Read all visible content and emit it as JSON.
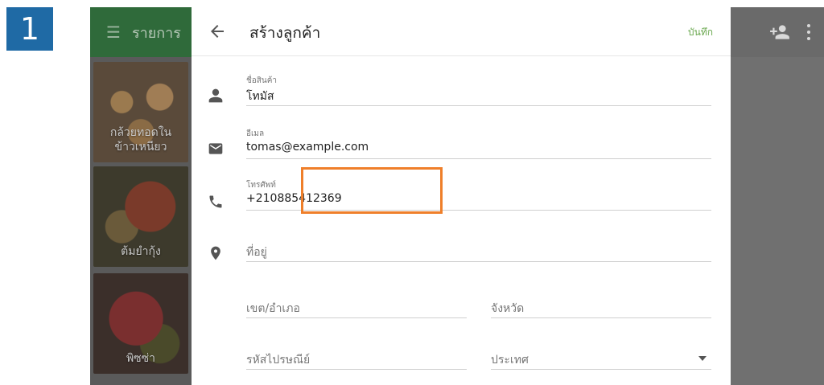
{
  "step": {
    "number": "1"
  },
  "background": {
    "left_title": "รายการ",
    "items": [
      {
        "label_line1": "กล้วยทอดใน",
        "label_line2": "ข้าวเหนียว"
      },
      {
        "label_line1": "ต้มยำกุ้ง",
        "label_line2": ""
      },
      {
        "label_line1": "พิซซ่า",
        "label_line2": ""
      }
    ]
  },
  "form": {
    "title": "สร้างลูกค้า",
    "save_label": "บันทึก",
    "fields": {
      "name": {
        "label": "ชื่อสินค้า",
        "value": "โทมัส"
      },
      "email": {
        "label": "อีเมล",
        "value": "tomas@example.com"
      },
      "phone": {
        "label": "โทรศัพท์",
        "value": "+210885412369"
      },
      "address": {
        "placeholder": "ที่อยู่"
      },
      "district": {
        "placeholder": "เขต/อำเภอ"
      },
      "province": {
        "placeholder": "จังหวัด"
      },
      "postal": {
        "placeholder": "รหัสไปรษณีย์"
      },
      "country": {
        "placeholder": "ประเทศ"
      }
    }
  },
  "colors": {
    "step_badge": "#1f6aa5",
    "highlight": "#ef7f2a",
    "save_text": "#6aa84f",
    "topbar_green": "#2f6a3a"
  },
  "icons": {
    "menu": "menu-icon",
    "back": "arrow-left-icon",
    "person": "person-icon",
    "mail": "mail-icon",
    "phone": "phone-icon",
    "location": "location-pin-icon",
    "add_person": "person-add-icon",
    "more": "more-vert-icon",
    "dropdown": "dropdown-arrow-icon"
  }
}
